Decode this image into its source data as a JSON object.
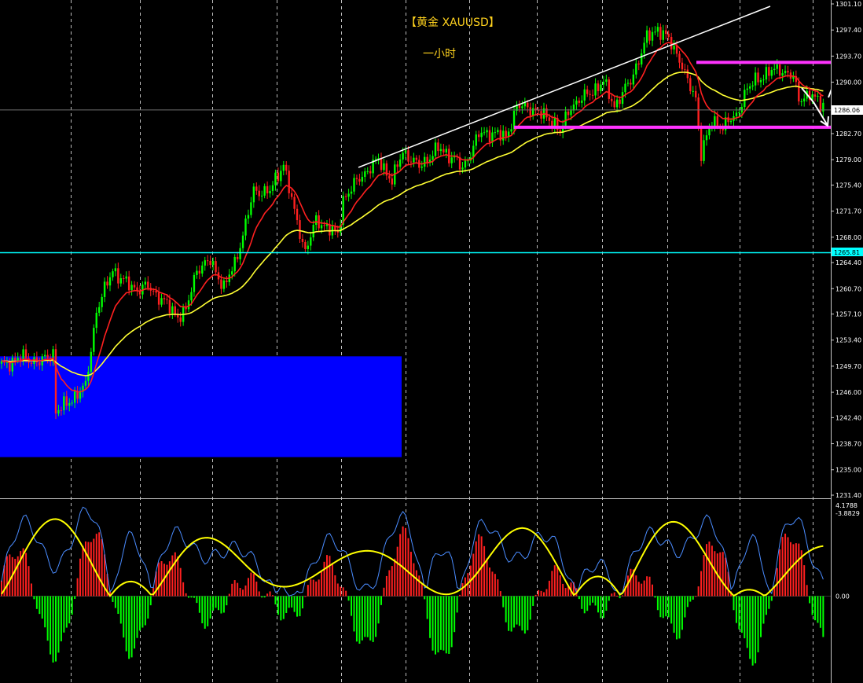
{
  "header": {
    "title": "【黄金 XAUUSD】",
    "subtitle": "一小时"
  },
  "colors": {
    "background": "#000000",
    "bull_candle": "#00ff00",
    "bear_candle": "#ff2020",
    "ma_fast": "#ff2020",
    "ma_slow": "#ffff33",
    "zone": "#0000ff",
    "resistance": "#ff33ff",
    "hline": "#00ffff",
    "trendline": "#ffffff",
    "macd_line": "#4a8cff",
    "signal_line": "#ffff00"
  },
  "chart_data": [
    {
      "type": "candlestick",
      "symbol": "XAUUSD",
      "price_ticks": [
        "1301.10",
        "1297.40",
        "1293.70",
        "1290.00",
        "1286.40",
        "1282.70",
        "1279.00",
        "1275.40",
        "1271.70",
        "1268.00",
        "1264.40",
        "1260.70",
        "1257.10",
        "1253.40",
        "1249.70",
        "1246.00",
        "1242.40",
        "1238.70",
        "1235.00",
        "1231.40"
      ],
      "ylim": [
        1231.4,
        1301.1
      ],
      "current_price_label": "1286.06",
      "current_price": 1286.06,
      "hline_label": "1265.81",
      "hline_price": 1265.81,
      "grid": "vertical-dashed",
      "demand_zone": [
        1236.8,
        1251.1
      ],
      "resistance_level": 1292.8,
      "support_level": 1283.6,
      "close_path": [
        [
          0,
          1249.8
        ],
        [
          8,
          1251.0
        ],
        [
          14,
          1250.2
        ],
        [
          19,
          1251.6
        ],
        [
          20,
          1243.2
        ],
        [
          24,
          1244.4
        ],
        [
          31,
          1246.8
        ],
        [
          35,
          1257.5
        ],
        [
          41,
          1263.5
        ],
        [
          44,
          1262.0
        ],
        [
          50,
          1260.6
        ],
        [
          54,
          1261.0
        ],
        [
          60,
          1258.8
        ],
        [
          65,
          1256.8
        ],
        [
          68,
          1257.5
        ],
        [
          72,
          1263.5
        ],
        [
          77,
          1264.6
        ],
        [
          82,
          1260.9
        ],
        [
          86,
          1264.2
        ],
        [
          89,
          1268.4
        ],
        [
          93,
          1274.5
        ],
        [
          99,
          1274.5
        ],
        [
          104,
          1278.5
        ],
        [
          108,
          1271.5
        ],
        [
          112,
          1266.0
        ],
        [
          116,
          1270.3
        ],
        [
          120,
          1269.5
        ],
        [
          124,
          1268.3
        ],
        [
          126,
          1273.4
        ],
        [
          132,
          1276.4
        ],
        [
          139,
          1279.0
        ],
        [
          144,
          1276.0
        ],
        [
          148,
          1280.2
        ],
        [
          154,
          1278.0
        ],
        [
          161,
          1280.6
        ],
        [
          167,
          1279.2
        ],
        [
          170,
          1277.6
        ],
        [
          176,
          1282.6
        ],
        [
          182,
          1282.8
        ],
        [
          186,
          1282.1
        ],
        [
          190,
          1286.6
        ],
        [
          196,
          1286.2
        ],
        [
          200,
          1285.2
        ],
        [
          204,
          1284.2
        ],
        [
          206,
          1282.9
        ],
        [
          210,
          1286.6
        ],
        [
          216,
          1288.2
        ],
        [
          222,
          1290.0
        ],
        [
          226,
          1286.6
        ],
        [
          232,
          1290.2
        ],
        [
          238,
          1296.3
        ],
        [
          242,
          1297.6
        ],
        [
          246,
          1296.0
        ],
        [
          250,
          1293.4
        ],
        [
          253,
          1290.0
        ],
        [
          256,
          1287.7
        ],
        [
          258,
          1280.0
        ],
        [
          262,
          1284.4
        ],
        [
          266,
          1283.8
        ],
        [
          271,
          1285.2
        ],
        [
          274,
          1288.4
        ],
        [
          278,
          1290.3
        ],
        [
          283,
          1291.4
        ],
        [
          287,
          1291.9
        ],
        [
          292,
          1290.6
        ],
        [
          294,
          1287.7
        ],
        [
          298,
          1288.2
        ],
        [
          302,
          1287.0
        ]
      ]
    },
    {
      "type": "histogram",
      "name": "macd",
      "ticks": [
        "4.1788",
        "0.00",
        "-3.8829"
      ],
      "ylim": [
        -3.8829,
        4.1788
      ]
    }
  ]
}
